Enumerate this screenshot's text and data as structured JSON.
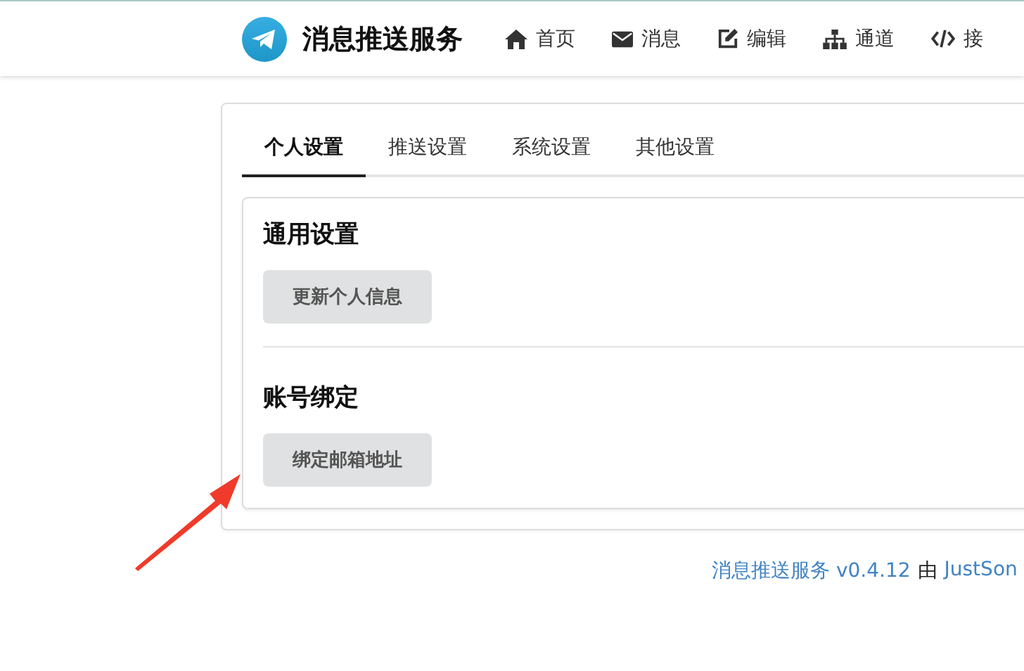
{
  "header": {
    "brand": "消息推送服务",
    "nav": [
      {
        "label": "首页"
      },
      {
        "label": "消息"
      },
      {
        "label": "编辑"
      },
      {
        "label": "通道"
      },
      {
        "label": "接"
      }
    ]
  },
  "tabs": [
    {
      "label": "个人设置",
      "selected": true
    },
    {
      "label": "推送设置",
      "selected": false
    },
    {
      "label": "系统设置",
      "selected": false
    },
    {
      "label": "其他设置",
      "selected": false
    }
  ],
  "sections": [
    {
      "heading": "通用设置",
      "button": "更新个人信息"
    },
    {
      "heading": "账号绑定",
      "button": "绑定邮箱地址"
    }
  ],
  "footer": {
    "app_link": "消息推送服务 v0.4.12",
    "by": "由",
    "author_link": "JustSon"
  }
}
